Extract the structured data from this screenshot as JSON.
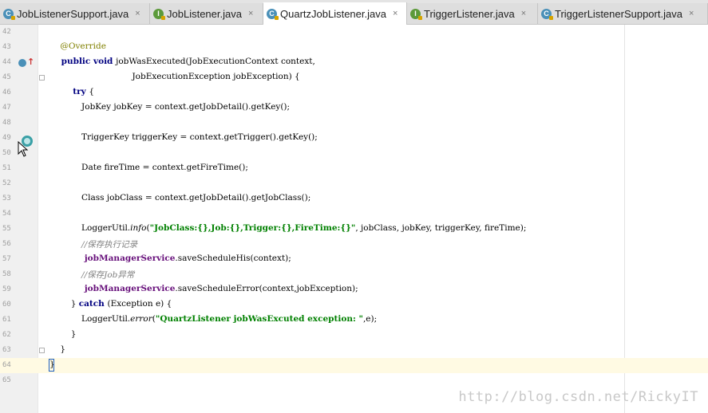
{
  "tabs": [
    {
      "label": "JobListenerSupport.java",
      "kind": "C",
      "close": "×",
      "active": false
    },
    {
      "label": "JobListener.java",
      "kind": "I",
      "close": "×",
      "active": false
    },
    {
      "label": "QuartzJobListener.java",
      "kind": "C",
      "close": "×",
      "active": true
    },
    {
      "label": "TriggerListener.java",
      "kind": "I",
      "close": "×",
      "active": false
    },
    {
      "label": "TriggerListenerSupport.java",
      "kind": "C",
      "close": "×",
      "active": false
    }
  ],
  "lines": [
    {
      "num": "42",
      "parts": []
    },
    {
      "num": "43",
      "parts": [
        [
          "ann",
          "    @Override"
        ]
      ]
    },
    {
      "num": "44",
      "parts": [
        [
          "kw",
          "    public void "
        ],
        [
          "",
          "jobWasExecuted(JobExecutionContext context,"
        ]
      ]
    },
    {
      "num": "45",
      "parts": [
        [
          "",
          "                               JobExecutionException jobException) {"
        ]
      ]
    },
    {
      "num": "46",
      "parts": [
        [
          "kw",
          "        try "
        ],
        [
          "",
          "{"
        ]
      ]
    },
    {
      "num": "47",
      "parts": [
        [
          "",
          "            JobKey jobKey = context.getJobDetail().getKey();"
        ]
      ]
    },
    {
      "num": "48",
      "parts": []
    },
    {
      "num": "49",
      "parts": [
        [
          "",
          "            TriggerKey triggerKey = context.getTrigger().getKey();"
        ]
      ]
    },
    {
      "num": "50",
      "parts": []
    },
    {
      "num": "51",
      "parts": [
        [
          "",
          "            Date fireTime = context.getFireTime();"
        ]
      ]
    },
    {
      "num": "52",
      "parts": []
    },
    {
      "num": "53",
      "parts": [
        [
          "",
          "            Class jobClass = context.getJobDetail().getJobClass();"
        ]
      ]
    },
    {
      "num": "54",
      "parts": []
    },
    {
      "num": "55",
      "parts": [
        [
          "",
          "            LoggerUtil."
        ],
        [
          "ital",
          "info"
        ],
        [
          "",
          "("
        ],
        [
          "str",
          "\"JobClass:{},Job:{},Trigger:{},FireTime:{}\""
        ],
        [
          "",
          ", jobClass, jobKey, triggerKey, fireTime);"
        ]
      ]
    },
    {
      "num": "56",
      "parts": [
        [
          "cmt",
          "            //保存执行记录"
        ]
      ]
    },
    {
      "num": "57",
      "parts": [
        [
          "fld",
          "            jobManagerService"
        ],
        [
          "",
          ".saveScheduleHis(context);"
        ]
      ]
    },
    {
      "num": "58",
      "parts": [
        [
          "cmt",
          "            //保存Job异常"
        ]
      ]
    },
    {
      "num": "59",
      "parts": [
        [
          "fld",
          "            jobManagerService"
        ],
        [
          "",
          ".saveScheduleError(context,jobException);"
        ]
      ]
    },
    {
      "num": "60",
      "parts": [
        [
          "",
          "        } "
        ],
        [
          "kw",
          "catch "
        ],
        [
          "",
          "(Exception e) {"
        ]
      ]
    },
    {
      "num": "61",
      "parts": [
        [
          "",
          "            LoggerUtil."
        ],
        [
          "ital",
          "error"
        ],
        [
          "",
          "("
        ],
        [
          "str",
          "\"QuartzListener jobWasExcuted exception: \""
        ],
        [
          "",
          ",e);"
        ]
      ]
    },
    {
      "num": "62",
      "parts": [
        [
          "",
          "        }"
        ]
      ]
    },
    {
      "num": "63",
      "parts": [
        [
          "",
          "    }"
        ]
      ]
    },
    {
      "num": "64",
      "parts": [
        [
          "",
          "}"
        ]
      ]
    },
    {
      "num": "65",
      "parts": []
    }
  ],
  "current_line": "64",
  "watermark": "http://blog.csdn.net/RickyIT",
  "colors": {
    "keyword": "#000080",
    "annotation": "#808000",
    "string": "#008000",
    "field": "#660e7a",
    "comment": "#808080"
  }
}
